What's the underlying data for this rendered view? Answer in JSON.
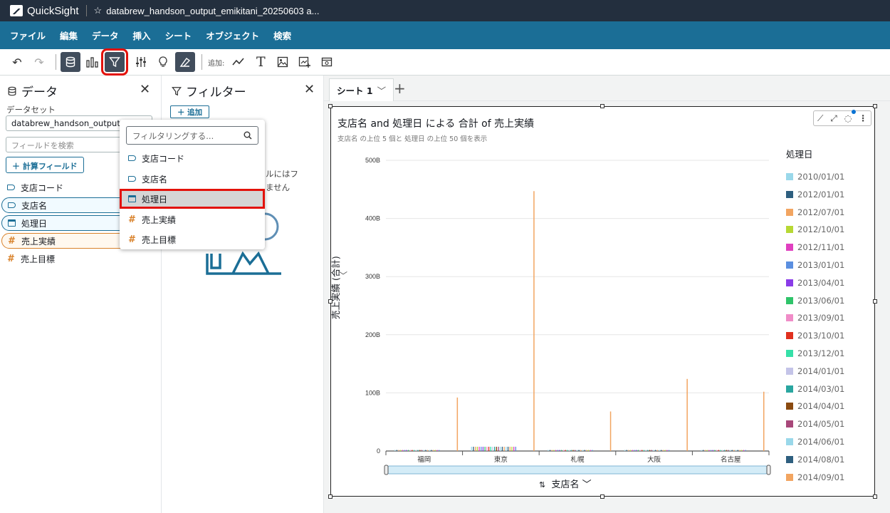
{
  "app": {
    "name": "QuickSight",
    "doc_title": "databrew_handson_output_emikitani_20250603 a..."
  },
  "menu": [
    "ファイル",
    "編集",
    "データ",
    "挿入",
    "シート",
    "オブジェクト",
    "検索"
  ],
  "toolbar": {
    "add_label": "追加:"
  },
  "data_panel": {
    "title": "データ",
    "dataset_label": "データセット",
    "dataset_value": "databrew_handson_output_",
    "search_placeholder": "フィールドを検索",
    "calc_button": "計算フィールド",
    "fields": [
      {
        "label": "支店コード",
        "kind": "dimension"
      },
      {
        "label": "支店名",
        "kind": "dimension"
      },
      {
        "label": "処理日",
        "kind": "date"
      },
      {
        "label": "売上実績",
        "kind": "measure"
      },
      {
        "label": "売上目標",
        "kind": "measure"
      }
    ]
  },
  "filter_panel": {
    "title": "フィルター",
    "add_button": "追加",
    "hint_line1": "ルにはフ",
    "hint_line2": "ません"
  },
  "dropdown": {
    "placeholder": "フィルタリングする...",
    "items": [
      {
        "label": "支店コード",
        "kind": "dimension"
      },
      {
        "label": "支店名",
        "kind": "dimension"
      },
      {
        "label": "処理日",
        "kind": "date"
      },
      {
        "label": "売上実績",
        "kind": "measure"
      },
      {
        "label": "売上目標",
        "kind": "measure"
      }
    ],
    "highlighted": "処理日"
  },
  "sheet": {
    "tab_label": "シート 1"
  },
  "visual": {
    "title": "支店名 and 処理日 による 合計 of 売上実績",
    "subtitle": "支店名 の上位 5 個と 処理日 の上位 50 個を表示",
    "y_axis_title": "売上実績 (合計)",
    "x_axis_title": "支店名",
    "legend_title": "処理日"
  },
  "legend": [
    {
      "label": "2010/01/01",
      "color": "#9ad8ea"
    },
    {
      "label": "2012/01/01",
      "color": "#2e5f7f"
    },
    {
      "label": "2012/07/01",
      "color": "#f2a561"
    },
    {
      "label": "2012/10/01",
      "color": "#b7d834"
    },
    {
      "label": "2012/11/01",
      "color": "#e040c0"
    },
    {
      "label": "2013/01/01",
      "color": "#5b8fe0"
    },
    {
      "label": "2013/04/01",
      "color": "#8a3ce8"
    },
    {
      "label": "2013/06/01",
      "color": "#2fc46a"
    },
    {
      "label": "2013/09/01",
      "color": "#f08cc8"
    },
    {
      "label": "2013/10/01",
      "color": "#e0301e"
    },
    {
      "label": "2013/12/01",
      "color": "#36e0a8"
    },
    {
      "label": "2014/01/01",
      "color": "#c4c4e8"
    },
    {
      "label": "2014/03/01",
      "color": "#2aa6a0"
    },
    {
      "label": "2014/04/01",
      "color": "#8a4a10"
    },
    {
      "label": "2014/05/01",
      "color": "#a8487a"
    },
    {
      "label": "2014/06/01",
      "color": "#9ad8ea"
    },
    {
      "label": "2014/08/01",
      "color": "#2e5f7f"
    },
    {
      "label": "2014/09/01",
      "color": "#f2a561"
    }
  ],
  "chart_data": {
    "type": "bar",
    "title": "支店名 and 処理日 による 合計 of 売上実績",
    "xlabel": "支店名",
    "ylabel": "売上実績 (合計)",
    "categories": [
      "福岡",
      "東京",
      "札幌",
      "大阪",
      "名古屋"
    ],
    "yticks": [
      "0",
      "100B",
      "200B",
      "300B",
      "400B",
      "500B"
    ],
    "ylim": [
      0,
      500
    ],
    "series": [
      {
        "name": "2012/07/01",
        "values": [
          92,
          447,
          68,
          124,
          102
        ]
      }
    ]
  }
}
